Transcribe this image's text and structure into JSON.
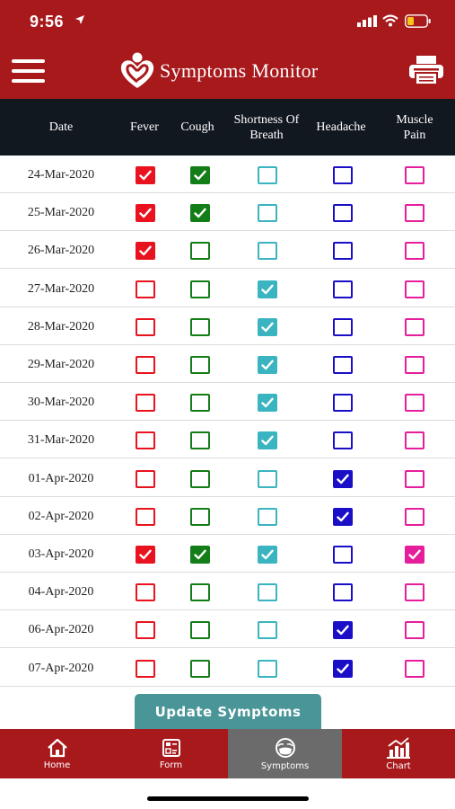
{
  "status_bar": {
    "time": "9:56"
  },
  "header": {
    "title": "Symptoms Monitor",
    "menu_icon": "hamburger-menu-icon",
    "logo_icon": "heart-person-logo",
    "print_icon": "printer-icon"
  },
  "table": {
    "columns": [
      {
        "id": "date",
        "label": [
          "Date"
        ]
      },
      {
        "id": "fever",
        "label": [
          "Fever"
        ],
        "color": "#e8131f"
      },
      {
        "id": "cough",
        "label": [
          "Cough"
        ],
        "color": "#137d17"
      },
      {
        "id": "breath",
        "label": [
          "Shortness Of",
          "Breath"
        ],
        "color": "#3ab4c1"
      },
      {
        "id": "headache",
        "label": [
          "Headache"
        ],
        "color": "#1a0fc7"
      },
      {
        "id": "muscle",
        "label": [
          "Muscle",
          "Pain"
        ],
        "color": "#e61e9b"
      }
    ],
    "rows": [
      {
        "date": "24-Mar-2020",
        "fever": true,
        "cough": true,
        "breath": false,
        "headache": false,
        "muscle": false
      },
      {
        "date": "25-Mar-2020",
        "fever": true,
        "cough": true,
        "breath": false,
        "headache": false,
        "muscle": false
      },
      {
        "date": "26-Mar-2020",
        "fever": true,
        "cough": false,
        "breath": false,
        "headache": false,
        "muscle": false
      },
      {
        "date": "27-Mar-2020",
        "fever": false,
        "cough": false,
        "breath": true,
        "headache": false,
        "muscle": false
      },
      {
        "date": "28-Mar-2020",
        "fever": false,
        "cough": false,
        "breath": true,
        "headache": false,
        "muscle": false
      },
      {
        "date": "29-Mar-2020",
        "fever": false,
        "cough": false,
        "breath": true,
        "headache": false,
        "muscle": false
      },
      {
        "date": "30-Mar-2020",
        "fever": false,
        "cough": false,
        "breath": true,
        "headache": false,
        "muscle": false
      },
      {
        "date": "31-Mar-2020",
        "fever": false,
        "cough": false,
        "breath": true,
        "headache": false,
        "muscle": false
      },
      {
        "date": "01-Apr-2020",
        "fever": false,
        "cough": false,
        "breath": false,
        "headache": true,
        "muscle": false
      },
      {
        "date": "02-Apr-2020",
        "fever": false,
        "cough": false,
        "breath": false,
        "headache": true,
        "muscle": false
      },
      {
        "date": "03-Apr-2020",
        "fever": true,
        "cough": true,
        "breath": true,
        "headache": false,
        "muscle": true
      },
      {
        "date": "04-Apr-2020",
        "fever": false,
        "cough": false,
        "breath": false,
        "headache": false,
        "muscle": false
      },
      {
        "date": "06-Apr-2020",
        "fever": false,
        "cough": false,
        "breath": false,
        "headache": true,
        "muscle": false
      },
      {
        "date": "07-Apr-2020",
        "fever": false,
        "cough": false,
        "breath": false,
        "headache": true,
        "muscle": false
      }
    ]
  },
  "update_button": {
    "label": "Update Symptoms"
  },
  "tabs": [
    {
      "id": "home",
      "label": "Home",
      "icon": "home-icon",
      "active": false
    },
    {
      "id": "form",
      "label": "Form",
      "icon": "form-icon",
      "active": false
    },
    {
      "id": "symptoms",
      "label": "Symptoms",
      "icon": "masked-face-icon",
      "active": true
    },
    {
      "id": "chart",
      "label": "Chart",
      "icon": "bar-chart-icon",
      "active": false
    }
  ],
  "colors": {
    "header_bg": "#a8191c",
    "table_header_bg": "#121820",
    "button_bg": "#4a9598",
    "active_tab_bg": "#6b6b6b"
  }
}
